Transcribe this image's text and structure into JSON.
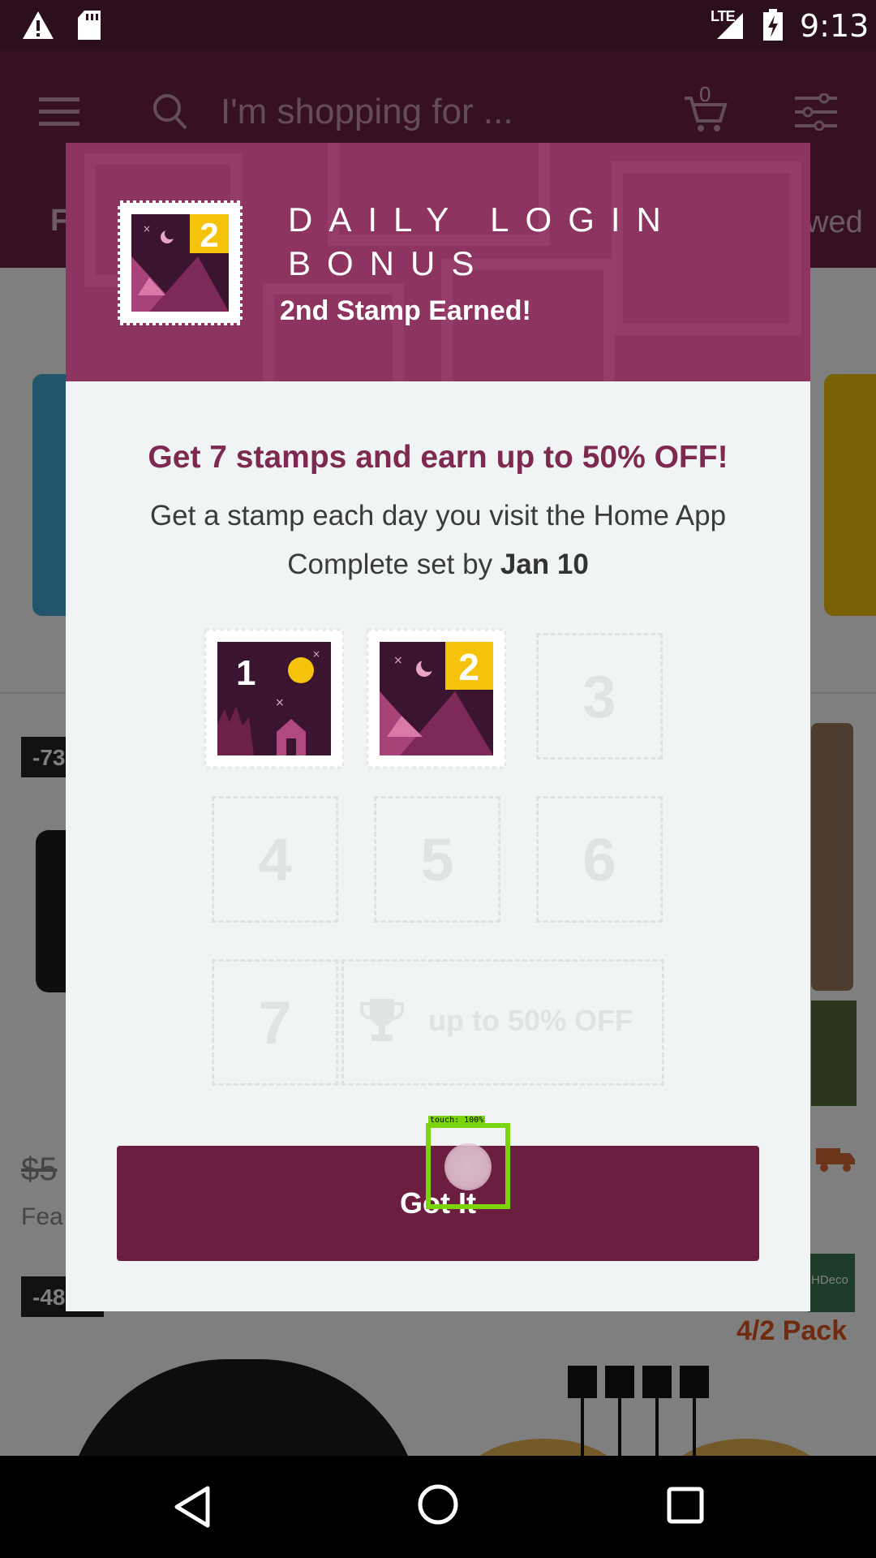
{
  "status_bar": {
    "network": "LTE",
    "time": "9:13",
    "icons": [
      "warning-icon",
      "sd-card-icon",
      "signal-icon",
      "battery-charging-icon"
    ]
  },
  "app": {
    "search_placeholder": "I'm shopping for ...",
    "cart_count": "0",
    "tab_left": "F",
    "tab_right": "wed",
    "discount_1": "-73",
    "discount_2": "-48",
    "old_price": "$5",
    "feature_text": "Fea",
    "brand_badge": "HDeco",
    "pack_text": "4/2 Pack"
  },
  "dialog": {
    "title": "DAILY LOGIN BONUS",
    "subtitle": "2nd Stamp Earned!",
    "header_stamp_number": "2",
    "headline": "Get 7 stamps and earn up to 50% OFF!",
    "description": "Get a stamp each day you visit the Home App",
    "date_prefix": "Complete set by ",
    "date": "Jan 10",
    "stamps": [
      {
        "number": "1",
        "earned": true
      },
      {
        "number": "2",
        "earned": true
      },
      {
        "number": "3",
        "earned": false
      },
      {
        "number": "4",
        "earned": false
      },
      {
        "number": "5",
        "earned": false
      },
      {
        "number": "6",
        "earned": false
      },
      {
        "number": "7",
        "earned": false
      }
    ],
    "reward_text": "up to 50% OFF",
    "button_label": "Got It"
  },
  "touch_overlay": {
    "label": "touch: 100%"
  },
  "colors": {
    "brand": "#6e2243",
    "button": "#6b1e3f",
    "header": "#8d3460",
    "headline": "#7e2a50",
    "stamp_yellow": "#f5c20c",
    "touch_box": "#7bd40e"
  }
}
